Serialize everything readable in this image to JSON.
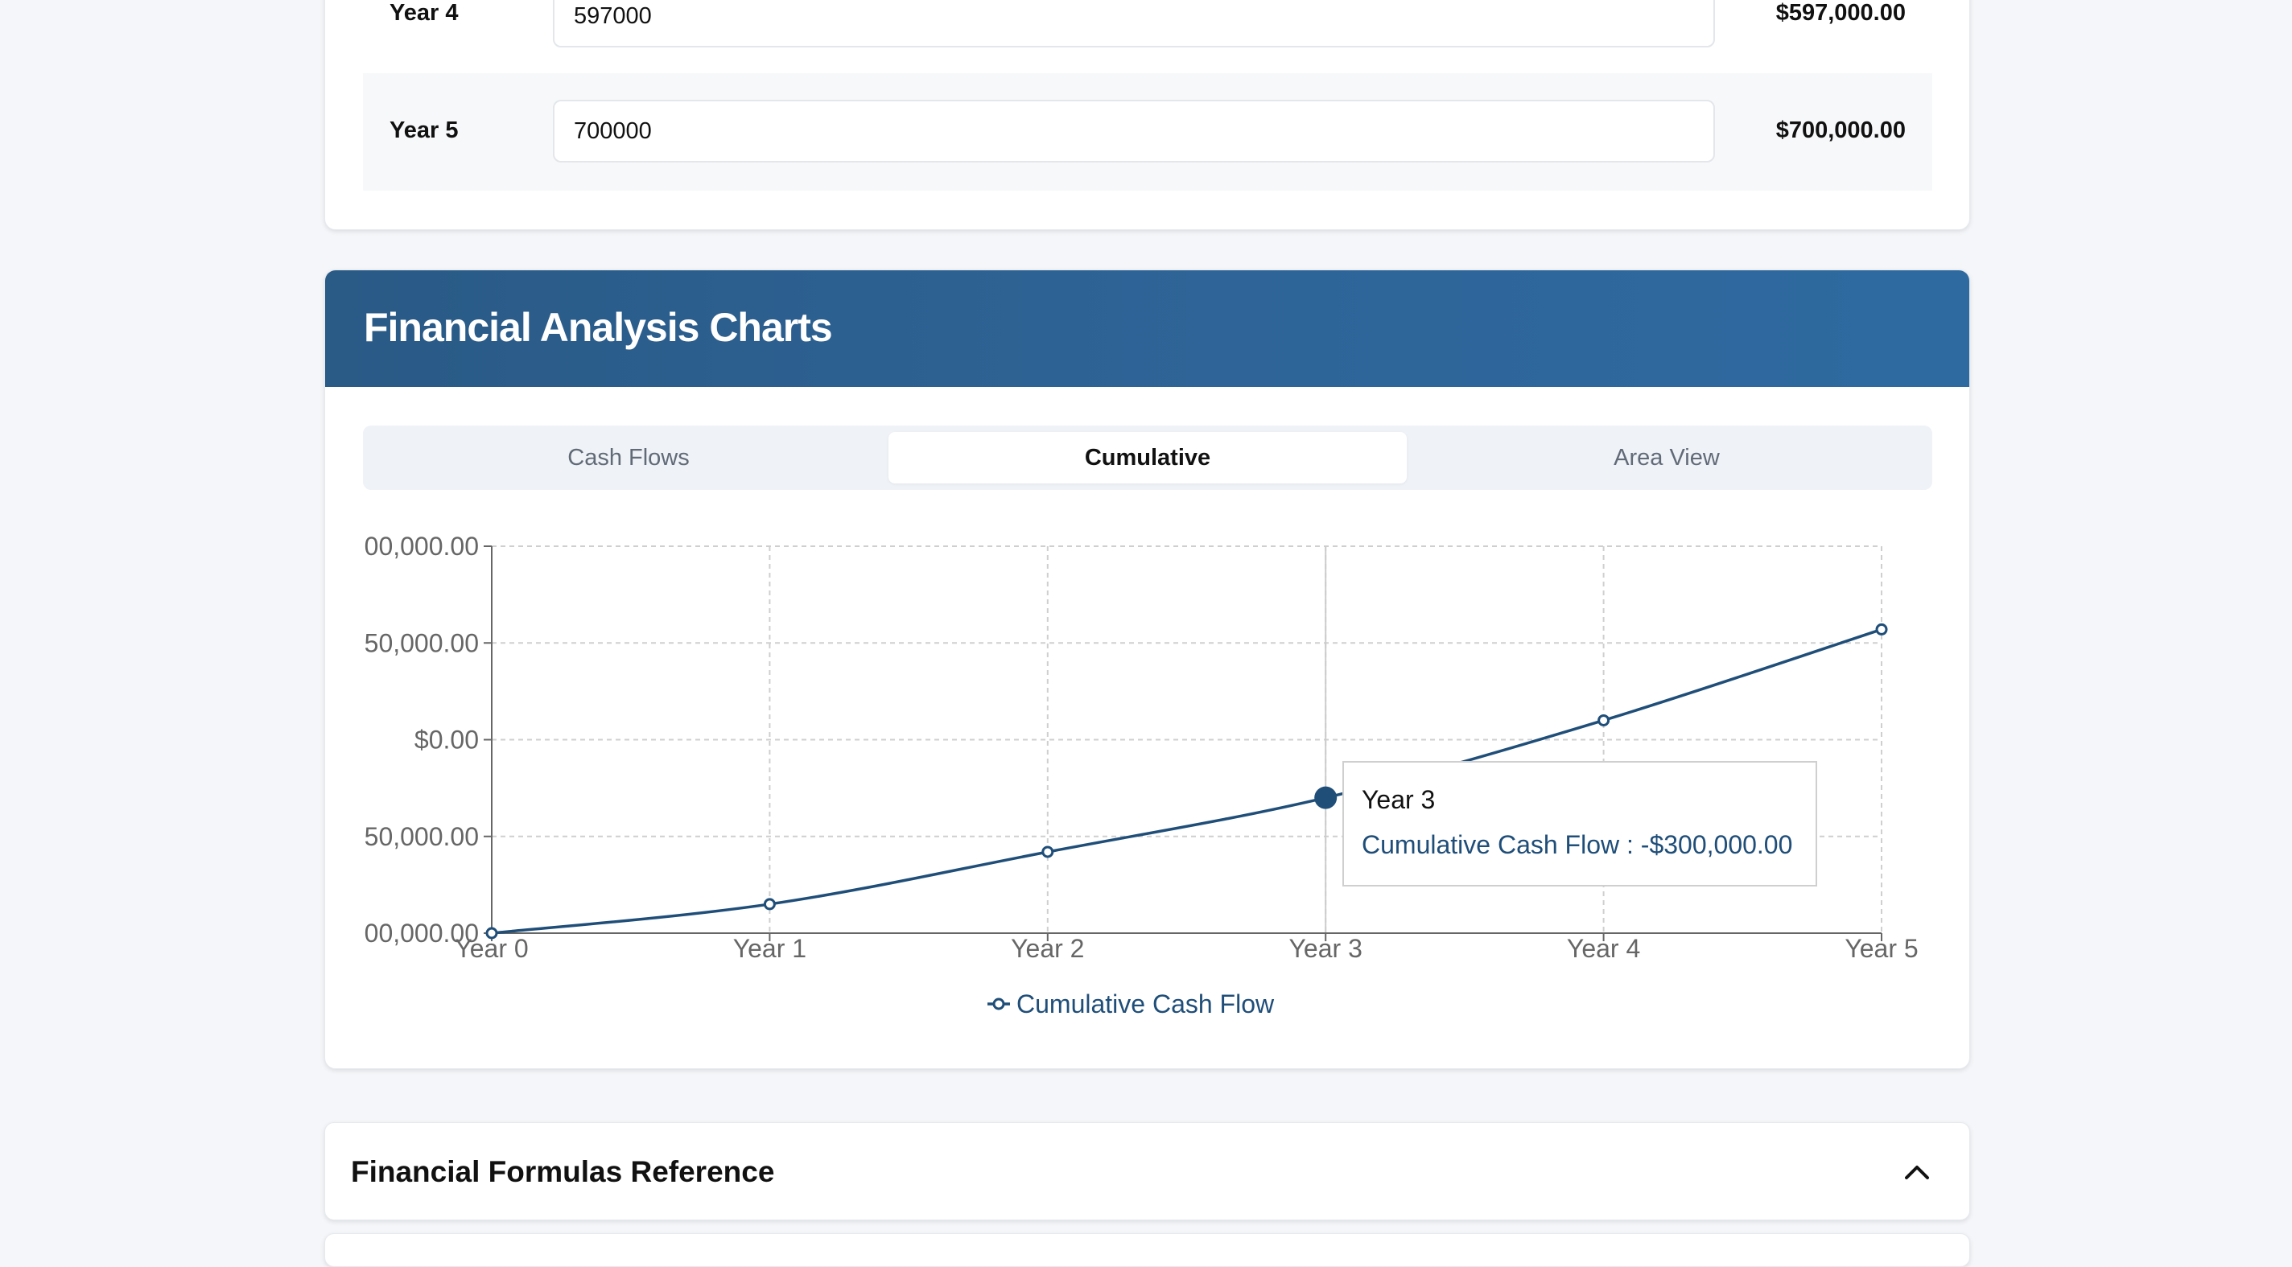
{
  "cash_flow_rows": [
    {
      "label": "Year 4",
      "input_value": "597000",
      "amount": "$597,000.00"
    },
    {
      "label": "Year 5",
      "input_value": "700000",
      "amount": "$700,000.00"
    }
  ],
  "charts_section": {
    "title": "Financial Analysis Charts",
    "tabs": [
      {
        "label": "Cash Flows",
        "active": false
      },
      {
        "label": "Cumulative",
        "active": true
      },
      {
        "label": "Area View",
        "active": false
      }
    ]
  },
  "chart_data": {
    "type": "line",
    "categories": [
      "Year 0",
      "Year 1",
      "Year 2",
      "Year 3",
      "Year 4",
      "Year 5"
    ],
    "series": [
      {
        "name": "Cumulative Cash Flow",
        "values": [
          -1000000,
          -850000,
          -580000,
          -300000,
          100000,
          570000
        ],
        "color": "#1f4e79"
      }
    ],
    "yticks": [
      -1000000,
      -500000,
      0,
      500000,
      1000000
    ],
    "ytick_labels": [
      "00,000.00",
      "50,000.00",
      "$0.00",
      "50,000.00",
      "00,000.00"
    ],
    "ylim": [
      -1000000,
      1000000
    ],
    "grid": true,
    "legend": "bottom",
    "tooltip": {
      "index": 3,
      "title": "Year 3",
      "text": "Cumulative Cash Flow : -$300,000.00"
    }
  },
  "accordion": {
    "title": "Financial Formulas Reference",
    "icon": "chevron-up-icon"
  },
  "colors": {
    "header": "#2b5f8f",
    "line": "#1f4e79",
    "background": "#f4f6f9"
  }
}
